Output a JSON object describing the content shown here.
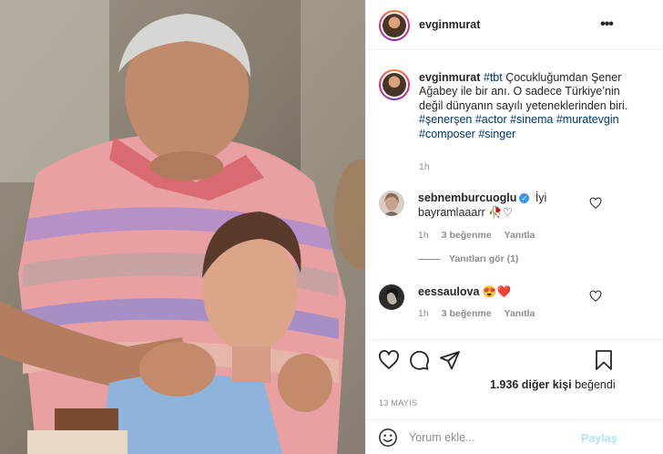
{
  "post": {
    "username": "evginmurat",
    "caption": {
      "username": "evginmurat",
      "parts": [
        {
          "text": "#tbt",
          "tag": true
        },
        {
          "text": " Çocukluğumdan Şener Ağabey ile bir anı. O sadece Türkiye’nin değil dünyanın sayılı yeteneklerinden biri. ",
          "tag": false
        },
        {
          "text": "#şenerşen",
          "tag": true
        },
        {
          "text": " ",
          "tag": false
        },
        {
          "text": "#actor",
          "tag": true
        },
        {
          "text": " ",
          "tag": false
        },
        {
          "text": "#sinema",
          "tag": true
        },
        {
          "text": " ",
          "tag": false
        },
        {
          "text": "#muratevgin",
          "tag": true
        },
        {
          "text": " ",
          "tag": false
        },
        {
          "text": "#composer",
          "tag": true
        },
        {
          "text": " ",
          "tag": false
        },
        {
          "text": "#singer",
          "tag": true
        }
      ],
      "time": "1h"
    },
    "comments": [
      {
        "username": "sebnemburcuoglu",
        "verified": true,
        "text": " İyi bayramlaaarr",
        "emoji": "🥀♡",
        "time": "1h",
        "likes": "3 beğenme",
        "reply_label": "Yanıtla"
      },
      {
        "username": "eessaulova",
        "verified": false,
        "text": " ",
        "emoji": "😍❤️",
        "time": "1h",
        "likes": "3 beğenme",
        "reply_label": "Yanıtla"
      }
    ],
    "view_replies": "Yanıtları gör (1)",
    "likes_prefix": "1.936 diğer kişi",
    "likes_suffix": " beğendi",
    "date": "13 MAYIS",
    "comment_placeholder": "Yorum ekle...",
    "post_button": "Paylaş",
    "icons": {
      "more": "more-options-icon",
      "like": "heart-icon",
      "comment": "comment-bubble-icon",
      "share": "paper-plane-icon",
      "save": "bookmark-icon",
      "emoji": "emoji-smile-icon"
    },
    "colors": {
      "hashtag": "#00376b",
      "muted": "#8e8e8e",
      "post_button": "#b2dffc",
      "verified": "#3897f0"
    }
  }
}
